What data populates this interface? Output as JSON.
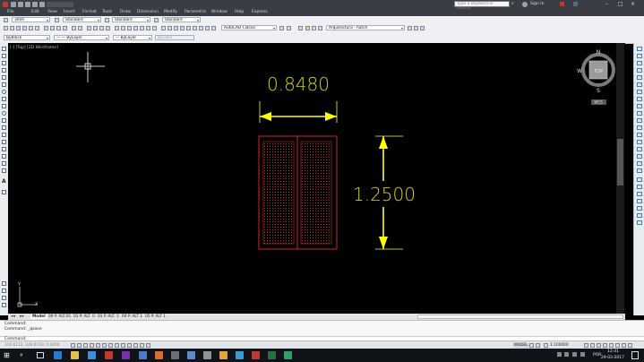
{
  "window": {
    "search_placeholder": "Type a keyword or phrase",
    "signin_label": "Sign In"
  },
  "menu": [
    "File",
    "Edit",
    "View",
    "Insert",
    "Format",
    "Tools",
    "Draw",
    "Dimension",
    "Modify",
    "Parametric",
    "Window",
    "Help",
    "Express"
  ],
  "styles_toolbar": {
    "text_style": "3mm",
    "dim_style": "Standard",
    "table_style": "Standard",
    "mleader_style": "Standard"
  },
  "workspace_toolbar": {
    "workspace": "AutoCAD Classic",
    "layer": "Arquitectura - hatch"
  },
  "properties_toolbar": {
    "color": "ByBlock",
    "linetype": "ByLayer",
    "lineweight": "ByLayer",
    "plotstyle": "ByColor"
  },
  "viewport": {
    "label": "[-] [Top] [2D Wireframe]",
    "viewcube_top": "TOP",
    "compass": {
      "n": "N",
      "s": "S",
      "e": "E",
      "w": "W"
    },
    "wcs_label": "WCS",
    "ucs_y": "Y",
    "ucs_x": "X"
  },
  "drawing": {
    "dim_horizontal": "0.8480",
    "dim_vertical": "1.2500",
    "dim_color": "#d4d400",
    "arrow_color": "#ffff00",
    "hatch_color": "#ff3030"
  },
  "layout_tabs": [
    "Model",
    "00 P. ALT.01",
    "01 P. ALT. 0",
    "03 P. ALT. 1",
    "04 P. ALT 1",
    "05 P. ALT 1"
  ],
  "command_lines": [
    "Command:",
    "Command:  _qsave"
  ],
  "command_prompt": "Command:",
  "status": {
    "coords": "310.6112, 248.8119, 0.0000",
    "model_label": "MODEL",
    "scale": "1:100000"
  },
  "clock": {
    "time": "12:41",
    "date": "29-03-2017",
    "lang": "POR"
  }
}
